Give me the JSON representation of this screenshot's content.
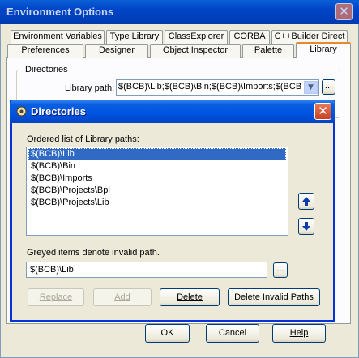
{
  "outer_window": {
    "title": "Environment Options",
    "tabs_row1": [
      "Environment Variables",
      "Type Library",
      "ClassExplorer",
      "CORBA",
      "C++Builder Direct"
    ],
    "tabs_row2": [
      "Preferences",
      "Designer",
      "Object Inspector",
      "Palette",
      "Library"
    ],
    "active_tab": "Library",
    "group_label": "Directories",
    "library_path_label": "Library path:",
    "library_path_value": "$(BCB)\\Lib;$(BCB)\\Bin;$(BCB)\\Imports;$(BCB)\\",
    "ellipsis_label": "...",
    "buttons": {
      "ok": "OK",
      "cancel": "Cancel",
      "help": "Help"
    }
  },
  "dialog": {
    "title": "Directories",
    "list_label": "Ordered list of Library paths:",
    "paths": [
      "$(BCB)\\Lib",
      "$(BCB)\\Bin",
      "$(BCB)\\Imports",
      "$(BCB)\\Projects\\Bpl",
      "$(BCB)\\Projects\\Lib"
    ],
    "selected_index": 0,
    "note": "Greyed items denote invalid path.",
    "path_input_value": "$(BCB)\\Lib",
    "ellipsis_label": "...",
    "buttons": {
      "replace": "Replace",
      "add": "Add",
      "delete": "Delete",
      "delete_invalid": "Delete Invalid Paths"
    },
    "icons": {
      "up": "arrow-up-icon",
      "down": "arrow-down-icon"
    },
    "accent_color": "#0054e3",
    "selection_color": "#316ac5"
  }
}
